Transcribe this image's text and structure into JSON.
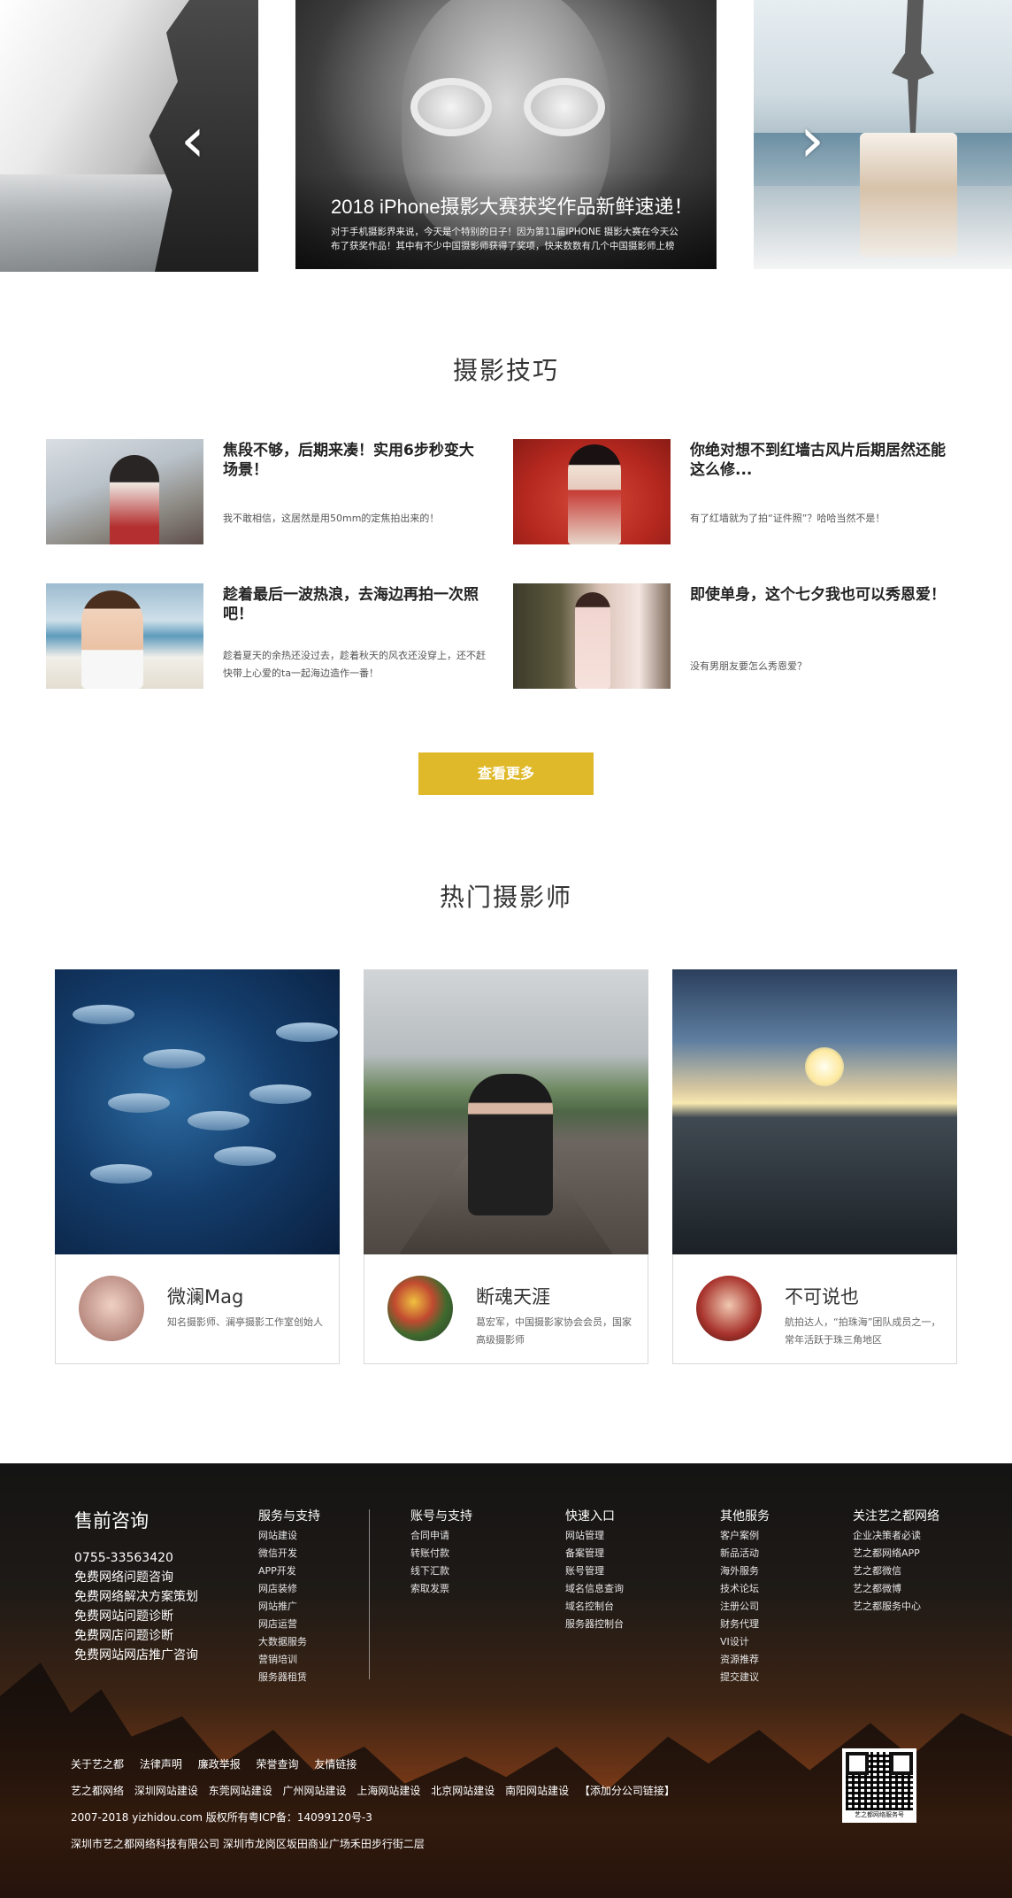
{
  "hero": {
    "slide_title": "2018 iPhone摄影大赛获奖作品新鲜速递！",
    "slide_desc": "对于手机摄影界来说，今天是个特别的日子！因为第11届IPHONE 摄影大赛在今天公布了获奖作品！其中有不少中国摄影师获得了奖项，快来数数有几个中国摄影师上榜吧！",
    "prev_icon": "chevron-left-icon",
    "next_icon": "chevron-right-icon",
    "prev_glyph": "‹",
    "next_glyph": "›"
  },
  "tips_section": {
    "title": "摄影技巧",
    "items": [
      {
        "title": "焦段不够，后期来凑！实用6步秒变大场景！",
        "desc": "我不敢相信，这居然是用50mm的定焦拍出来的！"
      },
      {
        "title": "你绝对想不到红墙古风片后期居然还能这么修...",
        "desc": "有了红墙就为了拍“证件照”？哈哈当然不是！"
      },
      {
        "title": "趁着最后一波热浪，去海边再拍一次照吧！",
        "desc": "趁着夏天的余热还没过去，趁着秋天的风衣还没穿上，还不赶快带上心爱的ta一起海边造作一番！"
      },
      {
        "title": "即使单身，这个七夕我也可以秀恩爱！",
        "desc": "没有男朋友要怎么秀恩爱？"
      }
    ],
    "more_label": "查看更多",
    "accent_color": "#e0b92a"
  },
  "photographers_section": {
    "title": "热门摄影师",
    "cards": [
      {
        "name": "微澜Mag",
        "desc": "知名摄影师、澜亭摄影工作室创始人"
      },
      {
        "name": "断魂天涯",
        "desc": "葛宏军，中国摄影家协会会员，国家高级摄影师"
      },
      {
        "name": "不可说也",
        "desc": "航拍达人，“拍珠海”团队成员之一，常年活跃于珠三角地区"
      }
    ]
  },
  "footer": {
    "presale": {
      "title": "售前咨询",
      "items": [
        "0755-33563420",
        "免费网络问题咨询",
        "免费网络解决方案策划",
        "免费网站问题诊断",
        "免费网店问题诊断",
        "免费网站网店推广咨询"
      ]
    },
    "columns": [
      {
        "title": "服务与支持",
        "items": [
          "网站建设",
          "微信开发",
          "APP开发",
          "网店装修",
          "网站推广",
          "网店运营",
          "大数据服务",
          "营销培训",
          "服务器租赁"
        ]
      },
      {
        "title": "账号与支持",
        "items": [
          "合同申请",
          "转账付款",
          "线下汇款",
          "索取发票"
        ]
      },
      {
        "title": "快速入口",
        "items": [
          "网站管理",
          "备案管理",
          "账号管理",
          "域名信息查询",
          "域名控制台",
          "服务器控制台"
        ]
      },
      {
        "title": "其他服务",
        "items": [
          "客户案例",
          "新品活动",
          "海外服务",
          "技术论坛",
          "注册公司",
          "财务代理",
          "VI设计",
          "资源推荐",
          "提交建议"
        ]
      },
      {
        "title": "关注艺之都网络",
        "items": [
          "企业决策者必读",
          "艺之都网络APP",
          "艺之都微信",
          "艺之都微博",
          "艺之都服务中心"
        ]
      }
    ],
    "bottom_links": [
      "关于艺之都",
      "法律声明",
      "廉政举报",
      "荣誉查询",
      "友情链接"
    ],
    "friend_links": [
      "艺之都网络",
      "深圳网站建设",
      "东莞网站建设",
      "广州网站建设",
      "上海网站建设",
      "北京网站建设",
      "南阳网站建设",
      "【添加分公司链接】"
    ],
    "copyright": "2007-2018 yizhidou.com 版权所有粤ICP备：14099120号-3",
    "address": "深圳市艺之都网络科技有限公司   深圳市龙岗区坂田商业广场禾田步行街二层",
    "qr_label": "艺之都网络服务号"
  }
}
